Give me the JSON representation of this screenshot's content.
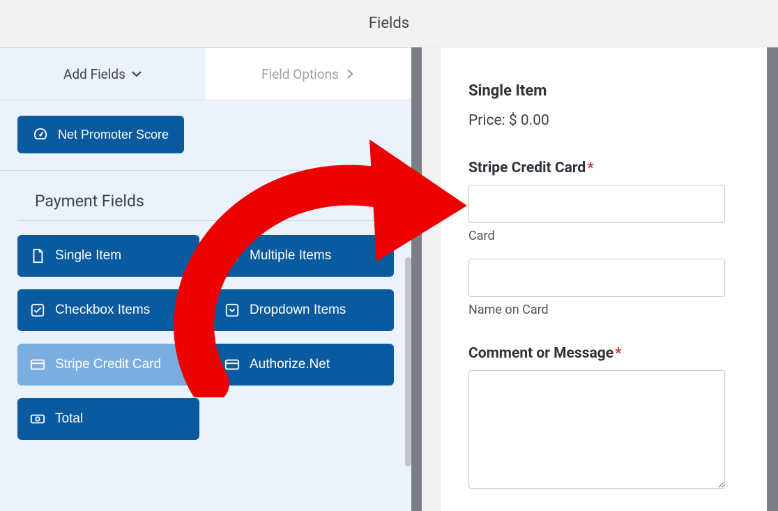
{
  "header": {
    "title": "Fields"
  },
  "tabs": {
    "add_fields": "Add Fields",
    "field_options": "Field Options"
  },
  "nps": {
    "label": "Net Promoter Score"
  },
  "payment": {
    "section_title": "Payment Fields",
    "items": {
      "single_item": "Single Item",
      "multiple_items": "Multiple Items",
      "checkbox_items": "Checkbox Items",
      "dropdown_items": "Dropdown Items",
      "stripe_cc": "Stripe Credit Card",
      "authorize_net": "Authorize.Net",
      "total": "Total"
    }
  },
  "preview": {
    "single_item_title": "Single Item",
    "price_label": "Price:",
    "price_value": "$ 0.00",
    "stripe_label": "Stripe Credit Card",
    "card_sub": "Card",
    "name_sub": "Name on Card",
    "comment_label": "Comment or Message"
  }
}
